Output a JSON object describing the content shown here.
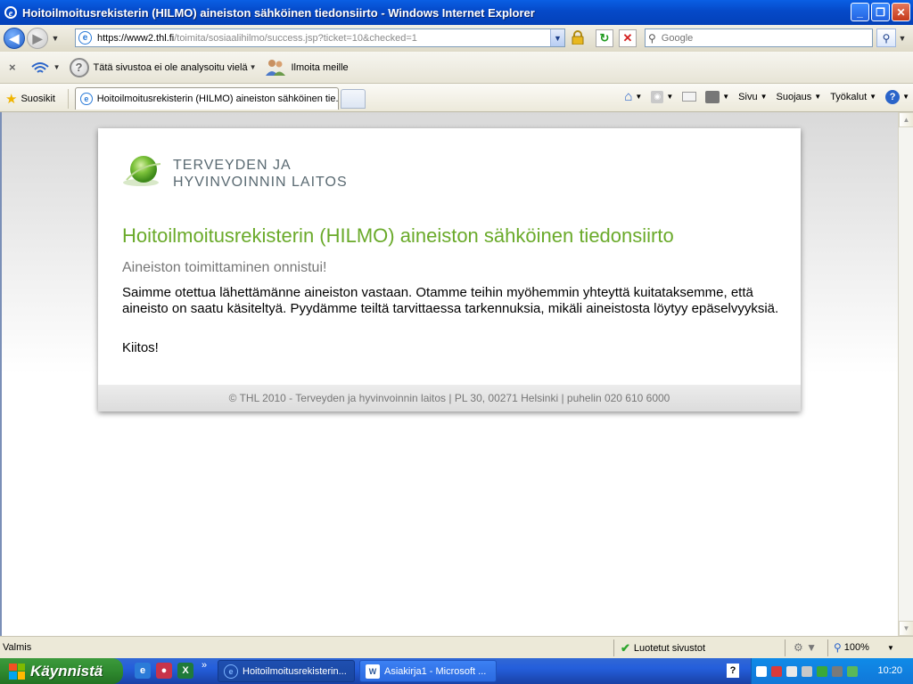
{
  "window": {
    "title": "Hoitoilmoitusrekisterin (HILMO) aineiston sähköinen tiedonsiirto - Windows Internet Explorer",
    "buttons": {
      "minimize": "_",
      "maximize": "❐",
      "close": "✕"
    }
  },
  "address": {
    "url_main": "https://www2.thl.fi",
    "url_rest": "/toimita/sosiaalihilmo/success.jsp?ticket=10&checked=1"
  },
  "search": {
    "placeholder": "Google"
  },
  "toolbar": {
    "phishing_status": "Tätä sivustoa ei ole analysoitu vielä",
    "report_label": "Ilmoita meille"
  },
  "tabs": {
    "favorites_label": "Suosikit",
    "active_tab_label": "Hoitoilmoitusrekisterin (HILMO) aineiston sähköinen tie..."
  },
  "command_bar": {
    "page_label": "Sivu",
    "safety_label": "Suojaus",
    "tools_label": "Työkalut"
  },
  "page": {
    "logo_line1": "TERVEYDEN JA",
    "logo_line2": "HYVINVOINNIN LAITOS",
    "heading": "Hoitoilmoitusrekisterin (HILMO) aineiston sähköinen tiedonsiirto",
    "subheading": "Aineiston toimittaminen onnistui!",
    "body": "Saimme otettua lähettämänne aineiston vastaan. Otamme teihin myöhemmin yhteyttä kuitataksemme, että aineisto on saatu käsiteltyä. Pyydämme teiltä tarvittaessa tarkennuksia, mikäli aineistosta löytyy epäselvyyksiä.",
    "thanks": "Kiitos!",
    "footer": "© THL 2010 - Terveyden ja hyvinvoinnin laitos | PL 30, 00271 Helsinki | puhelin 020 610 6000"
  },
  "status": {
    "ready": "Valmis",
    "zone": "Luotetut sivustot",
    "zoom": "100%"
  },
  "taskbar": {
    "start_label": "Käynnistä",
    "task_ie": "Hoitoilmoitusrekisterin...",
    "task_word": "Asiakirja1 - Microsoft ...",
    "clock": "10:20"
  },
  "colors": {
    "heading_green": "#6aaa2a",
    "xp_blue": "#245edb",
    "start_green": "#2f8a2f"
  }
}
